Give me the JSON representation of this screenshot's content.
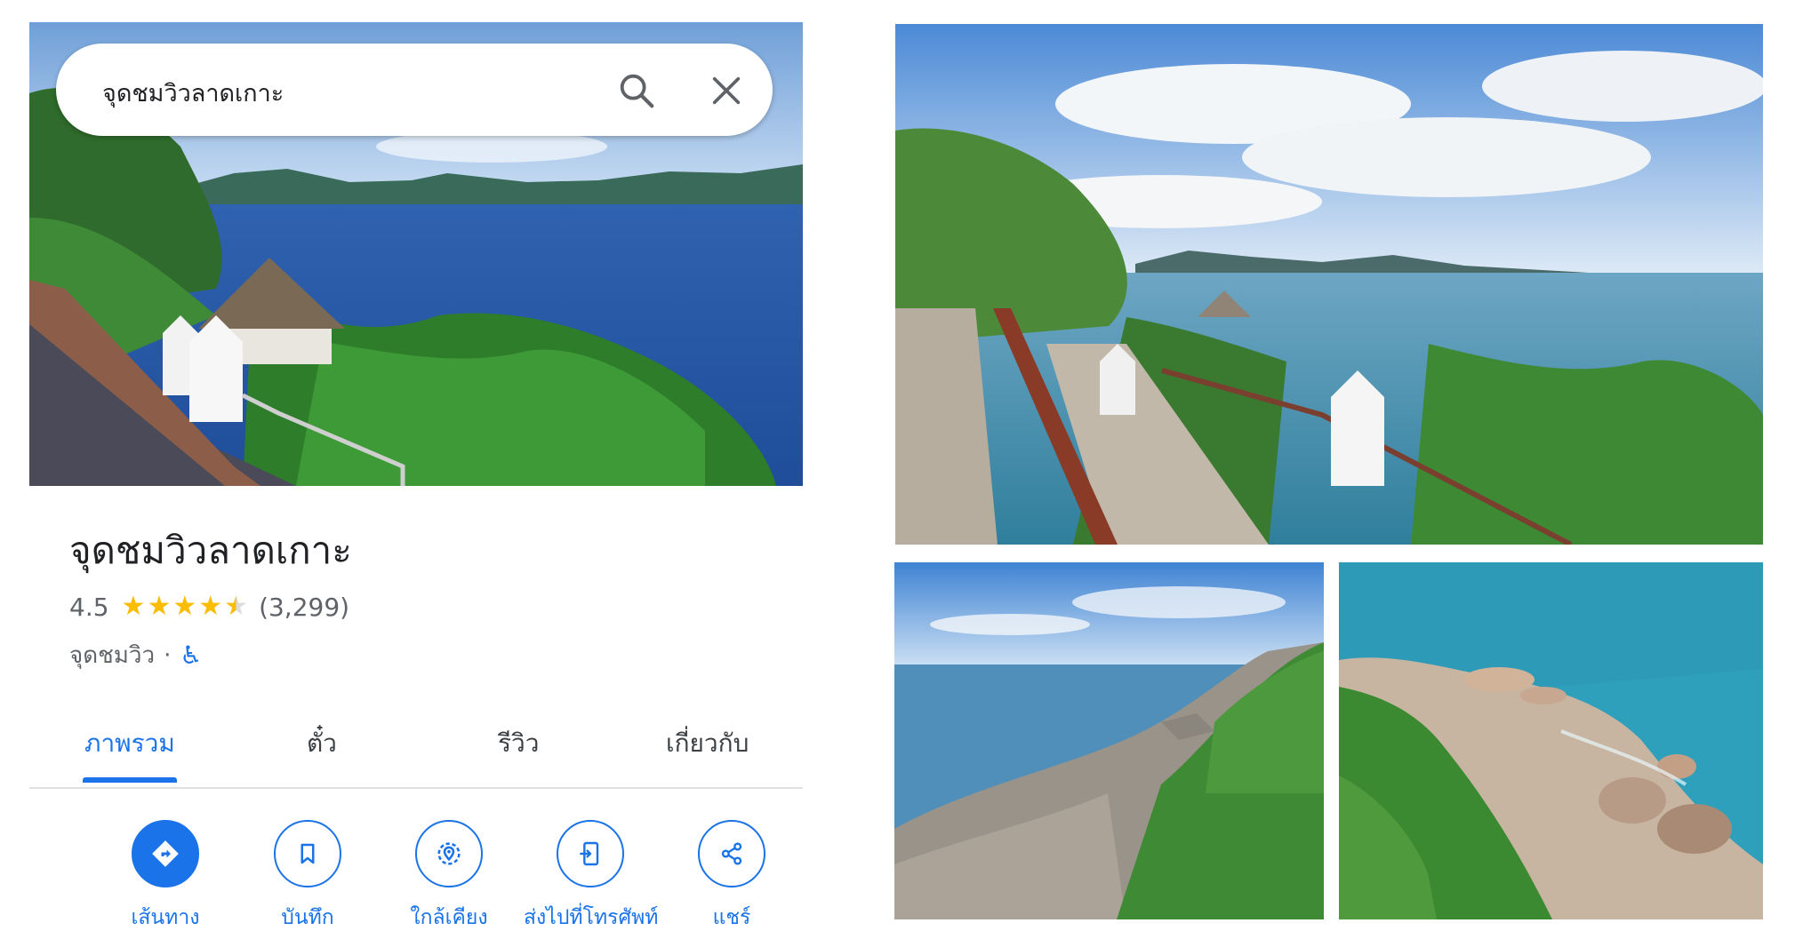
{
  "search": {
    "query": "จุดชมวิวลาดเกาะ",
    "search_icon": "search-icon",
    "close_icon": "close-icon"
  },
  "place": {
    "name": "จุดชมวิวลาดเกาะ",
    "rating": "4.5",
    "stars": 4.5,
    "review_count": "(3,299)",
    "category": "จุดชมวิว",
    "separator": "·",
    "accessibility_icon": "wheelchair-icon"
  },
  "tabs": [
    {
      "label": "ภาพรวม",
      "active": true
    },
    {
      "label": "ตั๋ว",
      "active": false
    },
    {
      "label": "รีวิว",
      "active": false
    },
    {
      "label": "เกี่ยวกับ",
      "active": false
    }
  ],
  "actions": [
    {
      "label": "เส้นทาง",
      "icon": "directions-icon"
    },
    {
      "label": "บันทึก",
      "icon": "bookmark-icon"
    },
    {
      "label": "ใกล้เคียง",
      "icon": "nearby-icon"
    },
    {
      "label": "ส่งไปที่โทรศัพท์",
      "icon": "send-to-phone-icon"
    },
    {
      "label": "แชร์",
      "icon": "share-icon"
    }
  ],
  "colors": {
    "accent": "#1a73e8",
    "star": "#fbbc04",
    "text_secondary": "#5f6368"
  }
}
